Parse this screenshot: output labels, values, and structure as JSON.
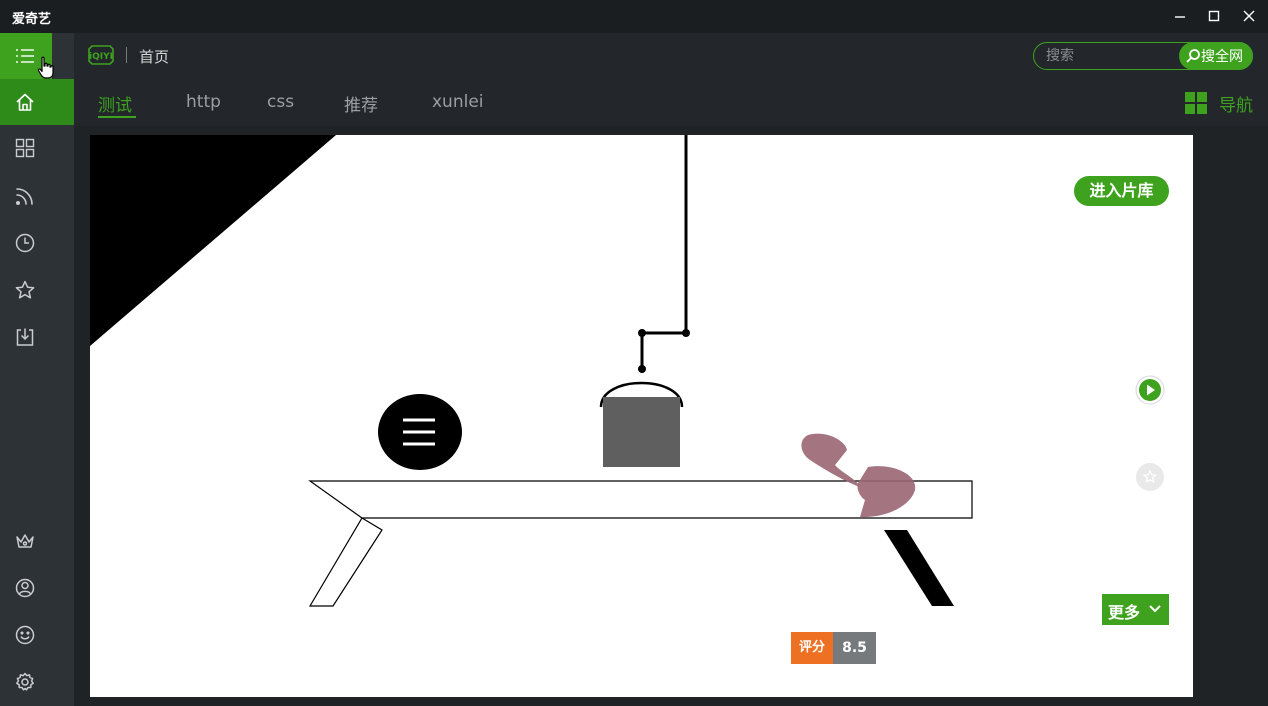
{
  "window": {
    "title": "爱奇艺",
    "controls": [
      "minimize-icon",
      "maximize-icon",
      "close-icon"
    ]
  },
  "sidebar": {
    "items": [
      {
        "id": "menu",
        "icon": "list-icon"
      },
      {
        "id": "home",
        "icon": "home-icon",
        "active": true
      },
      {
        "id": "apps",
        "icon": "grid-icon"
      },
      {
        "id": "feed",
        "icon": "rss-icon"
      },
      {
        "id": "history",
        "icon": "clock-icon"
      },
      {
        "id": "favorites",
        "icon": "star-icon"
      },
      {
        "id": "downloads",
        "icon": "download-icon"
      },
      {
        "id": "vip",
        "icon": "crown-icon"
      },
      {
        "id": "account",
        "icon": "user-icon"
      },
      {
        "id": "feedback",
        "icon": "smile-icon"
      },
      {
        "id": "settings",
        "icon": "gear-icon"
      }
    ]
  },
  "header": {
    "logo": "iQIYI",
    "breadcrumb": "首页",
    "search": {
      "placeholder": "搜索",
      "value": "",
      "button_label": "搜全网"
    },
    "tabs": [
      {
        "label": "测试",
        "active": true
      },
      {
        "label": "http",
        "active": false
      },
      {
        "label": "css",
        "active": false
      },
      {
        "label": "推荐",
        "active": false
      },
      {
        "label": "xunlei",
        "active": false
      }
    ],
    "nav_label": "导航"
  },
  "player": {
    "enter_library_label": "进入片库",
    "more_label": "更多",
    "rating_label": "评分",
    "rating_value": "8.5",
    "overlay_icons": [
      "play-icon",
      "star-icon"
    ]
  },
  "colors": {
    "accent": "#3ea21e",
    "sidebar_bg": "#2d3236",
    "titlebar_bg": "#1b1e21",
    "header_bg": "#23272b",
    "rating_orange": "#ee7022"
  }
}
